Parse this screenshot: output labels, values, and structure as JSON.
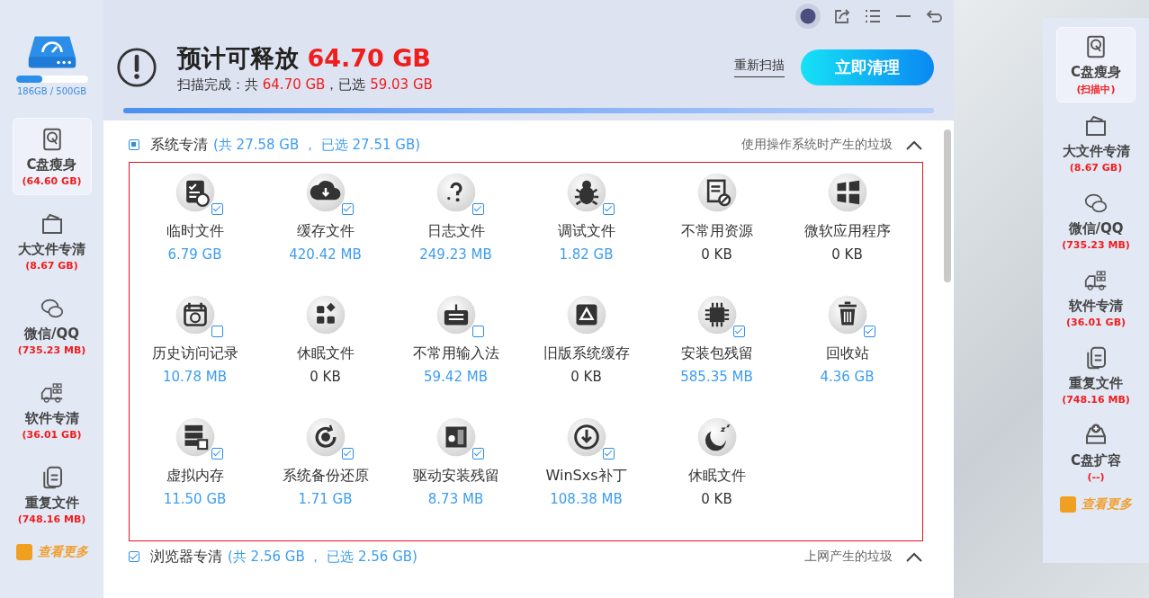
{
  "sidebar": {
    "disk_usage": {
      "level": 0.37,
      "label": "186GB / 500GB"
    },
    "items": [
      {
        "label": "C盘瘦身",
        "size": "(64.60 GB)",
        "selected": true
      },
      {
        "label": "大文件专清",
        "size": "(8.67 GB)",
        "selected": false
      },
      {
        "label": "微信/QQ",
        "size": "(735.23 MB)",
        "selected": false
      },
      {
        "label": "软件专清",
        "size": "(36.01 GB)",
        "selected": false
      },
      {
        "label": "重复文件",
        "size": "(748.16 MB)",
        "selected": false
      }
    ],
    "more": "查看更多"
  },
  "header": {
    "title": "预计可释放",
    "title_amount": "64.70 GB",
    "subtitle": [
      {
        "text": "扫描完成：共 ",
        "highlight": false
      },
      {
        "text": "64.70 GB",
        "highlight": true
      },
      {
        "text": "，已选 ",
        "highlight": false
      },
      {
        "text": "59.03 GB",
        "highlight": true
      }
    ],
    "rescan": "重新扫描",
    "clean": "立即清理",
    "scan_progress": {
      "level": 1
    }
  },
  "sections": [
    {
      "title": "系统专清",
      "summary": "(共 27.58 GB ， 已选 27.51 GB)",
      "description": "使用操作系统时产生的垃圾",
      "checked": true,
      "partial": true,
      "expanded": true,
      "items": [
        {
          "name": "临时文件",
          "size": "6.79 GB",
          "kind": "selectable",
          "checked": true
        },
        {
          "name": "缓存文件",
          "size": "420.42 MB",
          "kind": "selectable",
          "checked": true
        },
        {
          "name": "日志文件",
          "size": "249.23 MB",
          "kind": "selectable",
          "checked": true
        },
        {
          "name": "调试文件",
          "size": "1.82 GB",
          "kind": "selectable",
          "checked": true
        },
        {
          "name": "不常用资源",
          "size": "0 KB",
          "kind": "empty"
        },
        {
          "name": "微软应用程序",
          "size": "0 KB",
          "kind": "empty"
        },
        {
          "name": "历史访问记录",
          "size": "10.78 MB",
          "kind": "selectable",
          "checked": false
        },
        {
          "name": "休眠文件",
          "size": "0 KB",
          "kind": "empty"
        },
        {
          "name": "不常用输入法",
          "size": "59.42 MB",
          "kind": "selectable",
          "checked": false
        },
        {
          "name": "旧版系统缓存",
          "size": "0 KB",
          "kind": "empty"
        },
        {
          "name": "安装包残留",
          "size": "585.35 MB",
          "kind": "selectable",
          "checked": true
        },
        {
          "name": "回收站",
          "size": "4.36 GB",
          "kind": "selectable",
          "checked": true
        },
        {
          "name": "虚拟内存",
          "size": "11.50 GB",
          "kind": "selectable",
          "checked": true
        },
        {
          "name": "系统备份还原",
          "size": "1.71 GB",
          "kind": "selectable",
          "checked": true
        },
        {
          "name": "驱动安装残留",
          "size": "8.73 MB",
          "kind": "selectable",
          "checked": true
        },
        {
          "name": "WinSxs补丁",
          "size": "108.38 MB",
          "kind": "selectable",
          "checked": true
        },
        {
          "name": "休眠文件",
          "size": "0 KB",
          "kind": "empty"
        }
      ]
    },
    {
      "title": "浏览器专清",
      "summary": "(共 2.56 GB ， 已选 2.56 GB)",
      "description": "上网产生的垃圾",
      "checked": true,
      "expanded": true
    }
  ],
  "right_panel": {
    "items": [
      {
        "label": "C盘瘦身",
        "size": "(扫描中)",
        "selected": true
      },
      {
        "label": "大文件专清",
        "size": "(8.67 GB)",
        "selected": false
      },
      {
        "label": "微信/QQ",
        "size": "(735.23 MB)",
        "selected": false
      },
      {
        "label": "软件专清",
        "size": "(36.01 GB)",
        "selected": false
      },
      {
        "label": "重复文件",
        "size": "(748.16 MB)",
        "selected": false
      },
      {
        "label": "C盘扩容",
        "size": "(--)",
        "selected": false
      }
    ],
    "more": "查看更多"
  }
}
